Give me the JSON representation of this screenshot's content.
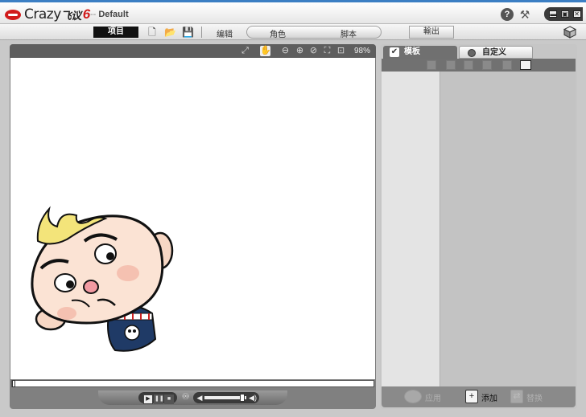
{
  "titlebar": {
    "logo_text": "Crazy",
    "logo_cn": "飞议",
    "logo_version": "6",
    "dash": "--",
    "document": "Default",
    "help_label": "?",
    "tools_glyph": "⚒",
    "window_controls": [
      "▬",
      "▣",
      "✕"
    ]
  },
  "menubar": {
    "project": "项目",
    "new_glyph": "🗋",
    "open_glyph": "📂",
    "save_glyph": "💾",
    "edit": "编辑",
    "role": "角色",
    "script": "脚本",
    "output": "輸出"
  },
  "stage": {
    "toolbar_icons": [
      "⤢",
      "✋",
      "⊖",
      "⊕",
      "⊘",
      "⛶",
      "⊡"
    ],
    "zoom": "98%",
    "playback": {
      "play": "▶",
      "pause": "❚❚",
      "stop": "■"
    },
    "loop_glyph": "♾",
    "volume": {
      "mute": "◀",
      "loud": "◀)",
      "level": 0.9
    }
  },
  "panel": {
    "tabs": {
      "template": "模板",
      "custom": "自定义"
    },
    "footer": {
      "apply": "应用",
      "add": "添加",
      "replace": "替换"
    }
  },
  "colors": {
    "accent_red": "#d11b1b",
    "title_blue": "#3c7fc4"
  }
}
